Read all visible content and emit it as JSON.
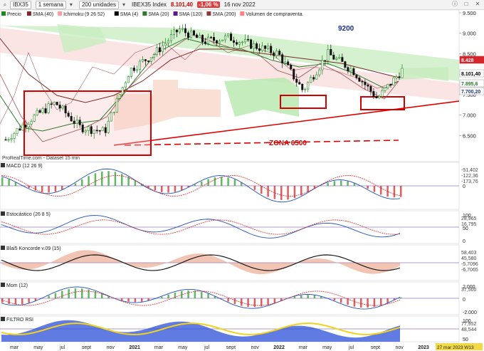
{
  "toolbar": {
    "symbol": "IBX35",
    "period": "1 semana",
    "units": "200 unidades",
    "instrument_name": "IBEX35 Index",
    "last_price": "8.101,40",
    "change": "-1,06 %",
    "date": "16 nov 2022"
  },
  "main_panel": {
    "legend": [
      "Precio",
      "SMA (40)",
      "Ichimoku (9 26 52)",
      "SMA (4)",
      "SMA (20)",
      "SMA (120)",
      "SMA (200)",
      "Volumen de compraventa"
    ],
    "annotation_9200": "9200",
    "annotation_zona": "ZONA 6500",
    "source": "ProRealTime.com - Dataset 15 min",
    "price_axis": [
      "9.500",
      "9.000",
      "8.500",
      "8.000",
      "7.500",
      "7.000",
      "6.500"
    ],
    "price_tags": [
      {
        "label": "8.428",
        "color": "#d6262b",
        "text_color": "#ffffff"
      },
      {
        "label": "8.101,40",
        "color": "#ffffff",
        "text_color": "#000000"
      },
      {
        "label": "7.895,6",
        "color": "#ffffff",
        "text_color": "#2a7a2a"
      },
      {
        "label": "7.700,20",
        "color": "#ffffff",
        "text_color": "#1b3a9a"
      }
    ]
  },
  "chart_data": {
    "type": "line",
    "title": "IBEX35 Index",
    "x": [
      "2020-03",
      "2020-05",
      "2020-07",
      "2020-09",
      "2020-11",
      "2021-01",
      "2021-03",
      "2021-05",
      "2021-07",
      "2021-09",
      "2021-11",
      "2022-01",
      "2022-03",
      "2022-05",
      "2022-07",
      "2022-09",
      "2022-11"
    ],
    "ylim": [
      6000,
      9500
    ],
    "series": [
      {
        "name": "Precio",
        "values": [
          6400,
          6900,
          7300,
          6700,
          6600,
          8100,
          8500,
          9100,
          8800,
          8900,
          8700,
          8500,
          7600,
          8500,
          8100,
          7400,
          8100
        ]
      }
    ],
    "resistance": 9200,
    "support_zone": 6500
  },
  "indicators": {
    "macd": {
      "name": "MACD (12 26 9)",
      "axis": [
        "0"
      ],
      "tags": [
        "-51,402",
        "-122,36",
        "-173,76"
      ]
    },
    "stoch": {
      "name": "Estocástico (26 8 5)",
      "axis": [
        "100",
        "50",
        "0"
      ],
      "tags": [
        "28,965",
        "16,795"
      ]
    },
    "koncorde": {
      "name": "Blai5 Koncorde v.09 (15)",
      "axis": [],
      "tags": [
        "58,403",
        "45,580",
        "-5,7096",
        "-6,7065"
      ]
    },
    "mom": {
      "name": "Mom (12)",
      "axis": [
        "2.000",
        "0",
        "-2.000"
      ],
      "tags": [
        "37,500"
      ]
    },
    "rsi": {
      "name": "FILTRO RSI",
      "axis": [
        "100",
        "50"
      ],
      "tags": [
        "77,952",
        "48,544"
      ]
    }
  },
  "x_axis": {
    "months": [
      "mar",
      "may",
      "jul",
      "sept",
      "nov",
      "2021",
      "mar",
      "may",
      "jul",
      "sept",
      "nov",
      "2022",
      "mar",
      "may",
      "jul",
      "sept",
      "nov",
      "2023"
    ],
    "end_date": "27 mar 2023 W13"
  },
  "colors": {
    "price_green": "#1a8a1a",
    "price_red": "#d6262b",
    "channel_green": "#b9e6b0",
    "channel_red": "#f4cccc",
    "support_red": "#e00000",
    "annotation_blue": "#1b2f8a"
  }
}
